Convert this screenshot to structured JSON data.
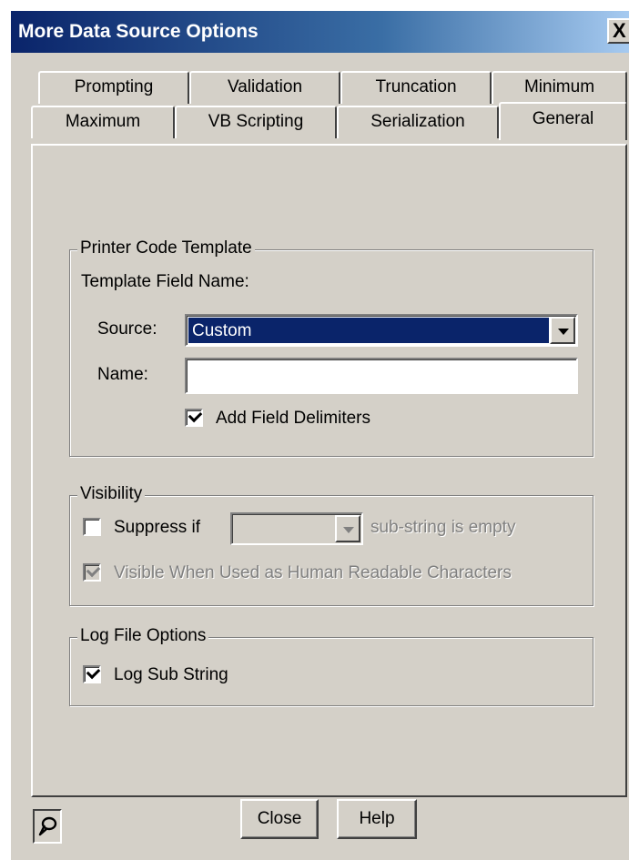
{
  "window": {
    "title": "More Data Source Options",
    "close_glyph": "X"
  },
  "tabs": {
    "row_back": [
      "Prompting",
      "Validation",
      "Truncation",
      "Minimum"
    ],
    "row_front": [
      "Maximum",
      "VB Scripting",
      "Serialization",
      "General"
    ],
    "selected": "General"
  },
  "printer_code_template": {
    "legend": "Printer Code Template",
    "template_field_name_label": "Template Field Name:",
    "source_label": "Source:",
    "source_value": "Custom",
    "name_label": "Name:",
    "name_value": "",
    "add_field_delimiters_label": "Add Field Delimiters",
    "add_field_delimiters_checked": true
  },
  "visibility": {
    "legend": "Visibility",
    "suppress_if_label": "Suppress if",
    "suppress_if_checked": false,
    "suppress_select_value": "",
    "substring_empty_label": "sub-string is empty",
    "visible_human_readable_label": "Visible When Used as Human Readable Characters",
    "visible_human_readable_checked": true
  },
  "log_file_options": {
    "legend": "Log File Options",
    "log_sub_string_label": "Log Sub String",
    "log_sub_string_checked": true
  },
  "footer": {
    "pin_icon": "pin-icon",
    "close_label": "Close",
    "help_label": "Help"
  },
  "colors": {
    "dialog_face": "#d4d0c8",
    "title_gradient_start": "#0a246a",
    "selection": "#0a246a"
  }
}
